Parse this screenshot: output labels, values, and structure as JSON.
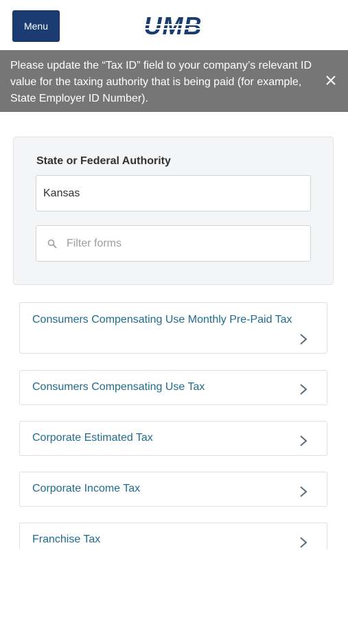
{
  "header": {
    "menu_label": "Menu",
    "logo_text": "UMB",
    "brand_color": "#1b3c72"
  },
  "banner": {
    "message": "Please update the “Tax ID” field to your company’s relevant ID value for the taxing authority that is being paid (for example, State Employer ID Number).",
    "close_icon": "close-icon",
    "background": "#767676"
  },
  "authority_panel": {
    "label": "State or Federal Authority",
    "selected_value": "Kansas",
    "filter_placeholder": "Filter forms",
    "filter_value": ""
  },
  "forms": [
    {
      "label": "Consumers Compensating Use Monthly Pre-Paid Tax"
    },
    {
      "label": "Consumers Compensating Use Tax"
    },
    {
      "label": "Corporate Estimated Tax"
    },
    {
      "label": "Corporate Income Tax"
    },
    {
      "label": "Franchise Tax"
    }
  ],
  "colors": {
    "link": "#1f6b8e",
    "panel_bg": "#f4f5f6"
  }
}
